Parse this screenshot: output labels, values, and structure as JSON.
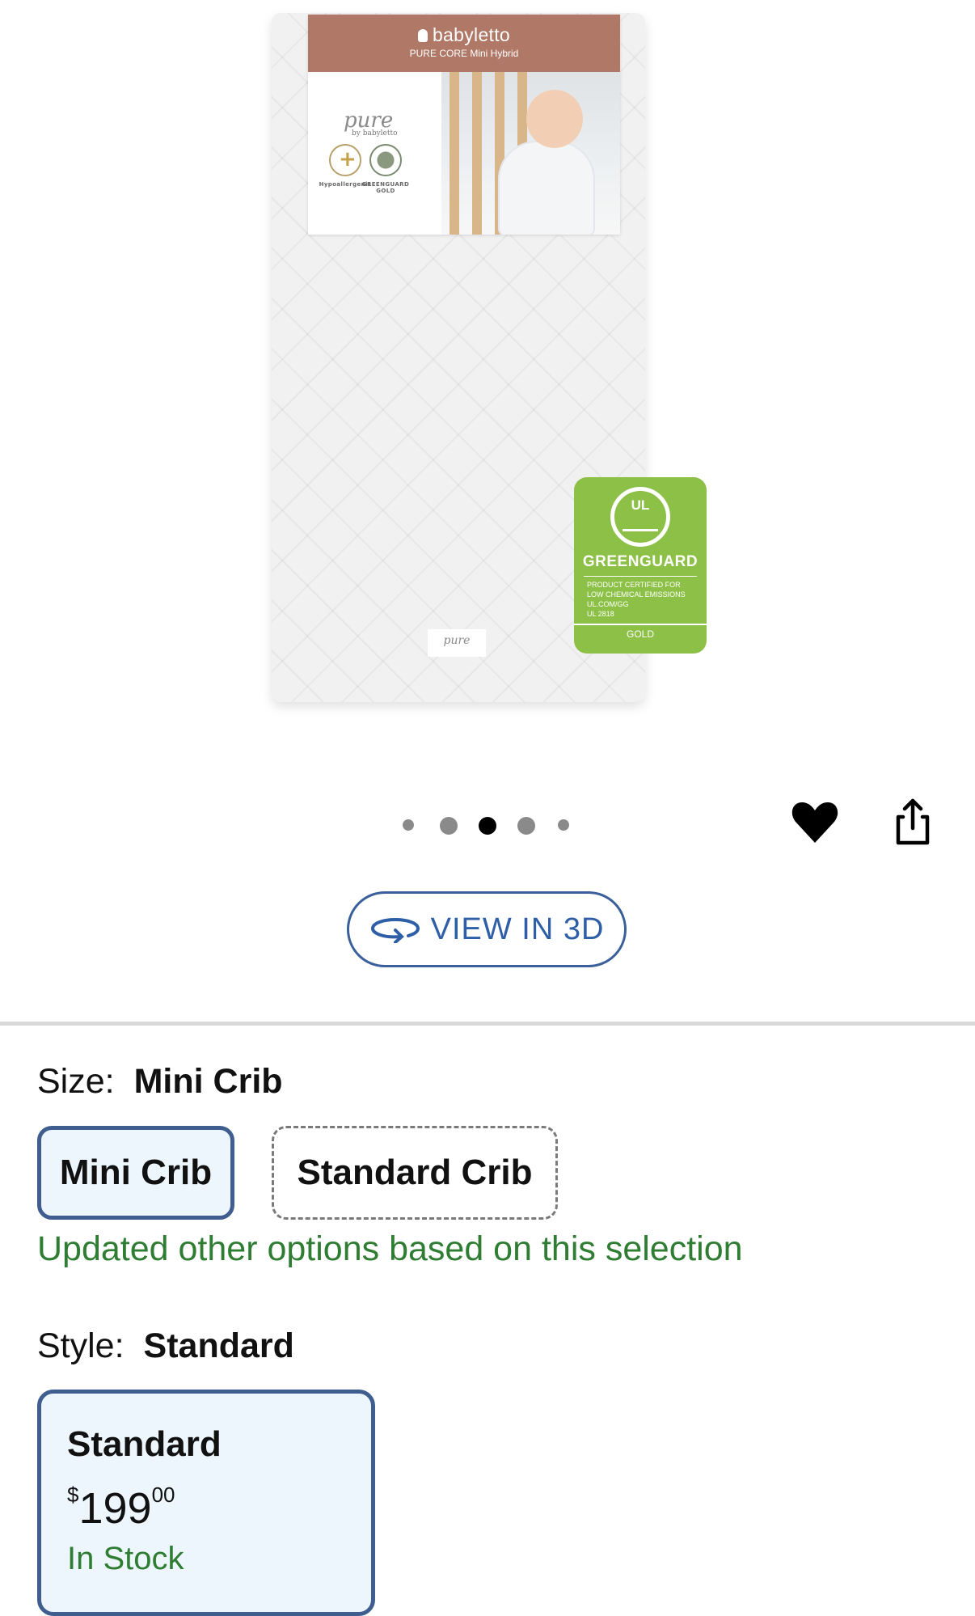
{
  "product_image": {
    "brand": "babyletto",
    "model": "PURE CORE Mini Hybrid",
    "pure_logo": "pure",
    "pure_logo_by": "by babyletto",
    "certs": [
      "Hypoallergenic",
      "GREENGUARD GOLD"
    ],
    "greenguard_badge": {
      "ul": "UL",
      "name": "GREENGUARD",
      "lines": [
        "PRODUCT CERTIFIED FOR",
        "LOW CHEMICAL EMISSIONS",
        "UL.COM/GG",
        "UL 2818"
      ],
      "level": "GOLD"
    }
  },
  "carousel": {
    "total": 5,
    "active_index": 2
  },
  "actions": {
    "favorite_icon": "heart-icon",
    "share_icon": "share-icon"
  },
  "view3d": {
    "label": "VIEW IN 3D",
    "icon": "rotate-3d-icon"
  },
  "size": {
    "label": "Size:",
    "selected_value": "Mini Crib",
    "options": [
      "Mini Crib",
      "Standard Crib"
    ],
    "update_message": "Updated other options based on this selection"
  },
  "style": {
    "label": "Style:",
    "selected_value": "Standard",
    "card": {
      "name": "Standard",
      "price_currency": "$",
      "price_whole": "199",
      "price_cents": "00",
      "availability": "In Stock"
    }
  },
  "colors": {
    "accent_blue": "#3f5e8f",
    "link_blue": "#2e5fa6",
    "success_green": "#2e7d32",
    "badge_green": "#8cc046"
  }
}
